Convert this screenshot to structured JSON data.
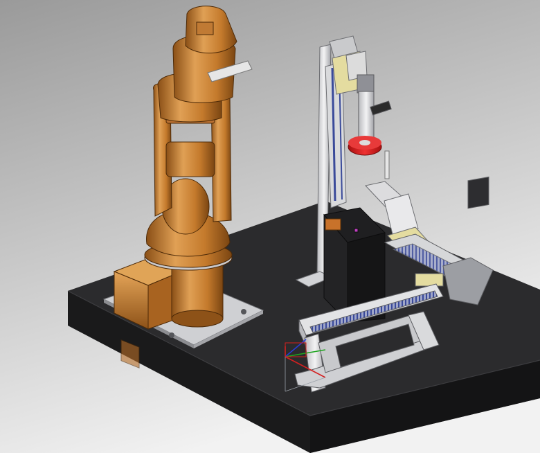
{
  "viewport": {
    "name": "cad-3d-viewport",
    "background_top": "#9a9a9a",
    "background_bottom": "#f2f2f2"
  },
  "colors": {
    "robot_orange": "#c47a2c",
    "robot_orange_dark": "#7a4512",
    "robot_orange_light": "#e8a65a",
    "table_top": "#2b2b2d",
    "table_side": "#1a1a1b",
    "metal": "#d7d7d9",
    "metal_dark": "#8f9096",
    "rail_blue": "#3a4a9a",
    "accent_red": "#d42020",
    "accent_yellow": "#e4dca0"
  },
  "scene_parts": [
    "workbench-table",
    "robot-arm",
    "robot-base-plate",
    "vertical-column-frame",
    "spindle-tool",
    "red-disc-gripper",
    "linear-rail-module",
    "side-rail-module",
    "workpiece-fixture",
    "coordinate-triad"
  ],
  "triad": {
    "x_color": "#d42020",
    "y_color": "#1fa51f",
    "z_color": "#2a3ad6"
  }
}
